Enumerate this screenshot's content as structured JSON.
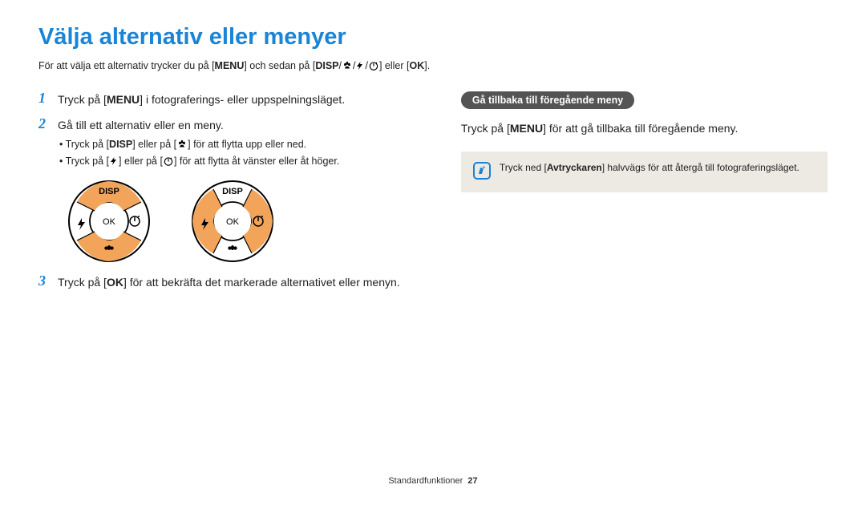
{
  "title": "Välja alternativ eller menyer",
  "intro": {
    "pre": "För att välja ett alternativ trycker du på [",
    "menu": "MENU",
    "mid": "] och sedan på [",
    "disp": "DISP",
    "after_icons": "] eller [",
    "ok": "OK",
    "end": "]."
  },
  "steps": [
    {
      "pre": "Tryck på [",
      "menu": "MENU",
      "post": "] i fotograferings- eller uppspelningsläget."
    },
    {
      "main": "Gå till ett alternativ eller en meny.",
      "bullets": [
        {
          "pre": "Tryck på [",
          "a": "DISP",
          "mid": "] eller på [",
          "tail": "] för att flytta upp eller ned.",
          "icon_b": "flower"
        },
        {
          "pre": "Tryck på [",
          "mid_icons": "flash_timer_left",
          "mid": "] eller på [",
          "tail": "] för att flytta åt vänster eller åt höger.",
          "icon_a": "flash",
          "icon_b": "timer"
        }
      ]
    },
    {
      "pre": "Tryck på [",
      "ok": "OK",
      "post": "] för att bekräfta det markerade alternativet eller menyn."
    }
  ],
  "diagrams": {
    "disp": "DISP",
    "ok": "OK"
  },
  "right": {
    "pill": "Gå tillbaka till föregående meny",
    "line_pre": "Tryck på [",
    "menu": "MENU",
    "line_post": "] för att gå tillbaka till föregående meny.",
    "note_pre": "Tryck ned [",
    "note_bold": "Avtryckaren",
    "note_post": "] halvvägs för att återgå till fotograferingsläget."
  },
  "footer": {
    "label": "Standardfunktioner",
    "page": "27"
  }
}
